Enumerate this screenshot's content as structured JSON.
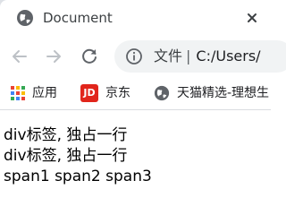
{
  "tab": {
    "title": "Document",
    "favicon": "globe-icon",
    "close_icon": "close-icon"
  },
  "toolbar": {
    "back_icon": "arrow-left-icon",
    "forward_icon": "arrow-right-icon",
    "reload_icon": "reload-icon",
    "info_icon": "info-icon",
    "address_label": "文件",
    "address_url": "C:/Users/"
  },
  "bookmarks": [
    {
      "label": "应用",
      "icon": "apps-grid-icon"
    },
    {
      "label": "京东",
      "icon": "jd-logo-icon",
      "icon_text": "JD"
    },
    {
      "label": "天猫精选-理想生",
      "icon": "globe-icon"
    }
  ],
  "page": {
    "lines": [
      "div标签, 独占一行",
      "div标签, 独占一行"
    ],
    "spans": [
      "span1",
      "span2",
      "span3"
    ]
  },
  "colors": {
    "tabstrip": "#dee1e6",
    "omnibox": "#f1f3f4",
    "icon": "#5f6368",
    "jd_brand": "#e1251b"
  }
}
